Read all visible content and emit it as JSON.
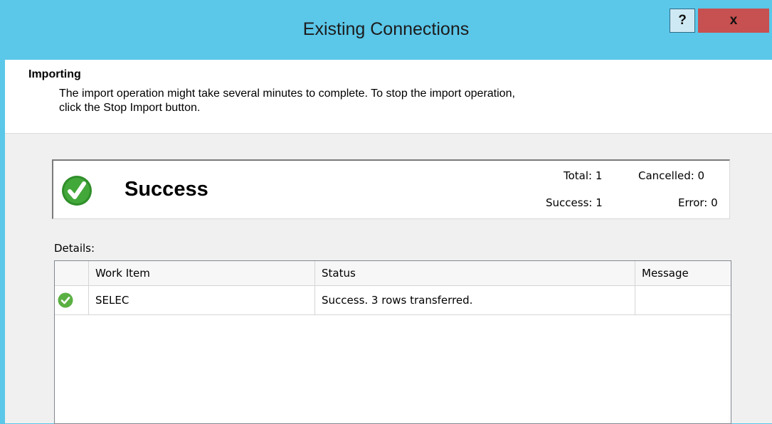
{
  "window": {
    "title": "Existing Connections",
    "help_label": "?",
    "close_label": "x"
  },
  "header": {
    "title": "Importing",
    "description_line1": "The import operation might take several minutes to complete. To stop the import operation,",
    "description_line2": "click the Stop Import button."
  },
  "status": {
    "icon": "success-check-icon",
    "label": "Success",
    "total": "Total: 1",
    "cancelled": "Cancelled: 0",
    "success": "Success: 1",
    "error": "Error: 0"
  },
  "details": {
    "label": "Details:",
    "columns": [
      "",
      "Work Item",
      "Status",
      "Message"
    ],
    "rows": [
      {
        "icon": "success-check-icon",
        "work_item": "SELEC",
        "status": "Success. 3 rows transferred.",
        "message": ""
      }
    ]
  },
  "colors": {
    "titlebar": "#5bc7e9",
    "close_button": "#c75050",
    "success_green": "#3c9a2f"
  }
}
